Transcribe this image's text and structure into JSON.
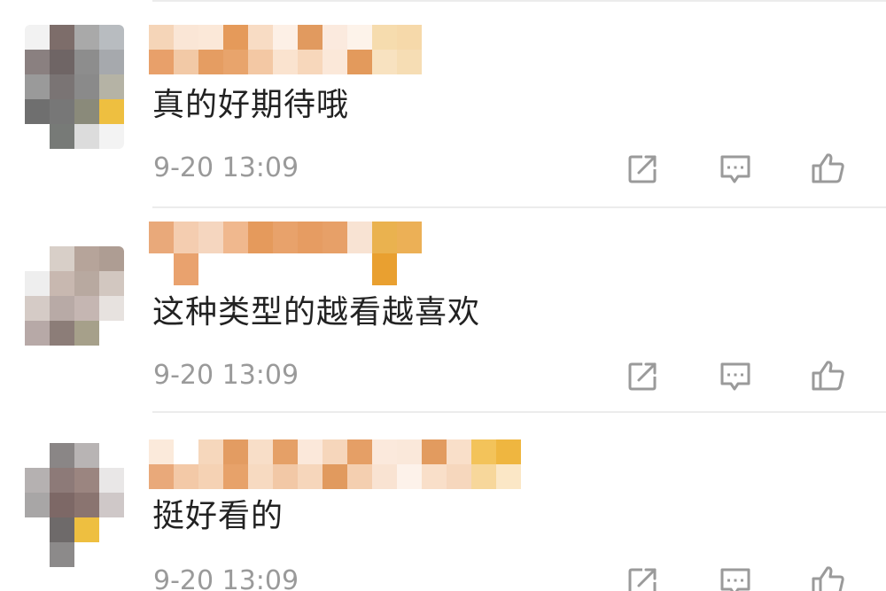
{
  "comments": [
    {
      "text": "真的好期待哦",
      "time": "9-20 13:09",
      "avatar_icon": "pixelated-avatar",
      "username_icon": "pixelated-username",
      "actions": [
        "share-icon",
        "reply-icon",
        "like-icon"
      ]
    },
    {
      "text": "这种类型的越看越喜欢",
      "time": "9-20 13:09",
      "avatar_icon": "pixelated-avatar",
      "username_icon": "pixelated-username",
      "actions": [
        "share-icon",
        "reply-icon",
        "like-icon"
      ]
    },
    {
      "text": "挺好看的",
      "time": "9-20 13:09",
      "avatar_icon": "pixelated-avatar",
      "username_icon": "pixelated-username",
      "actions": [
        "share-icon",
        "reply-icon",
        "like-icon"
      ]
    }
  ],
  "colors": {
    "text": "#222222",
    "timestamp": "#9a9a9a",
    "icon": "#9a9a9a",
    "divider": "#ececec",
    "username_orange": "#e09a5c",
    "username_light": "#f5dcc4"
  }
}
